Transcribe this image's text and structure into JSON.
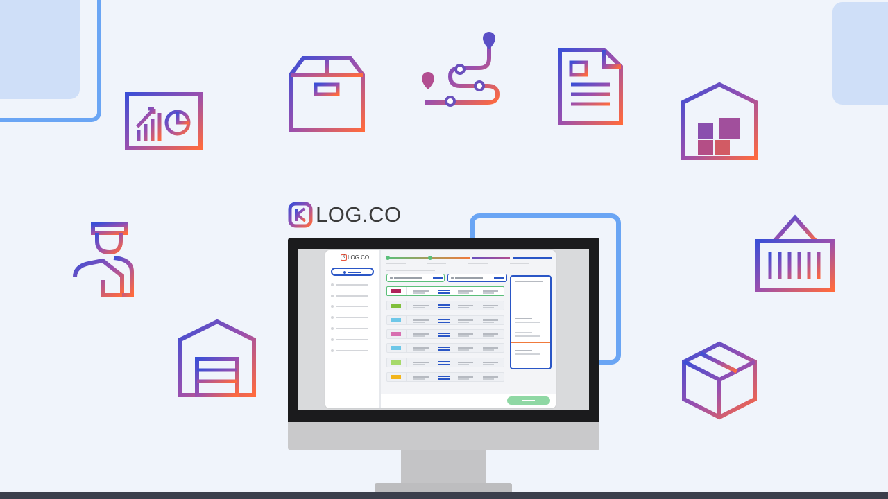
{
  "brand": {
    "name": "LOG.CO",
    "logo_letter": "K",
    "colors": {
      "orange": "#ff6a3d",
      "purple": "#8e54b6",
      "blue": "#2a56c6",
      "green": "#5bbf7a"
    }
  },
  "icons": [
    "analytics-board-icon",
    "package-box-icon",
    "route-map-icon",
    "document-icon",
    "warehouse-icon",
    "delivery-person-icon",
    "garage-warehouse-icon",
    "shipping-container-icon",
    "cube-box-icon"
  ],
  "app_window": {
    "sidebar_logo": "LOG.CO",
    "sidebar_items": 7,
    "swatches": [
      "#b0245a",
      "#7fbf3b",
      "#6ec7e8",
      "#d86fb0",
      "#6ec7e8",
      "#a6d96a",
      "#f2b51b"
    ]
  }
}
